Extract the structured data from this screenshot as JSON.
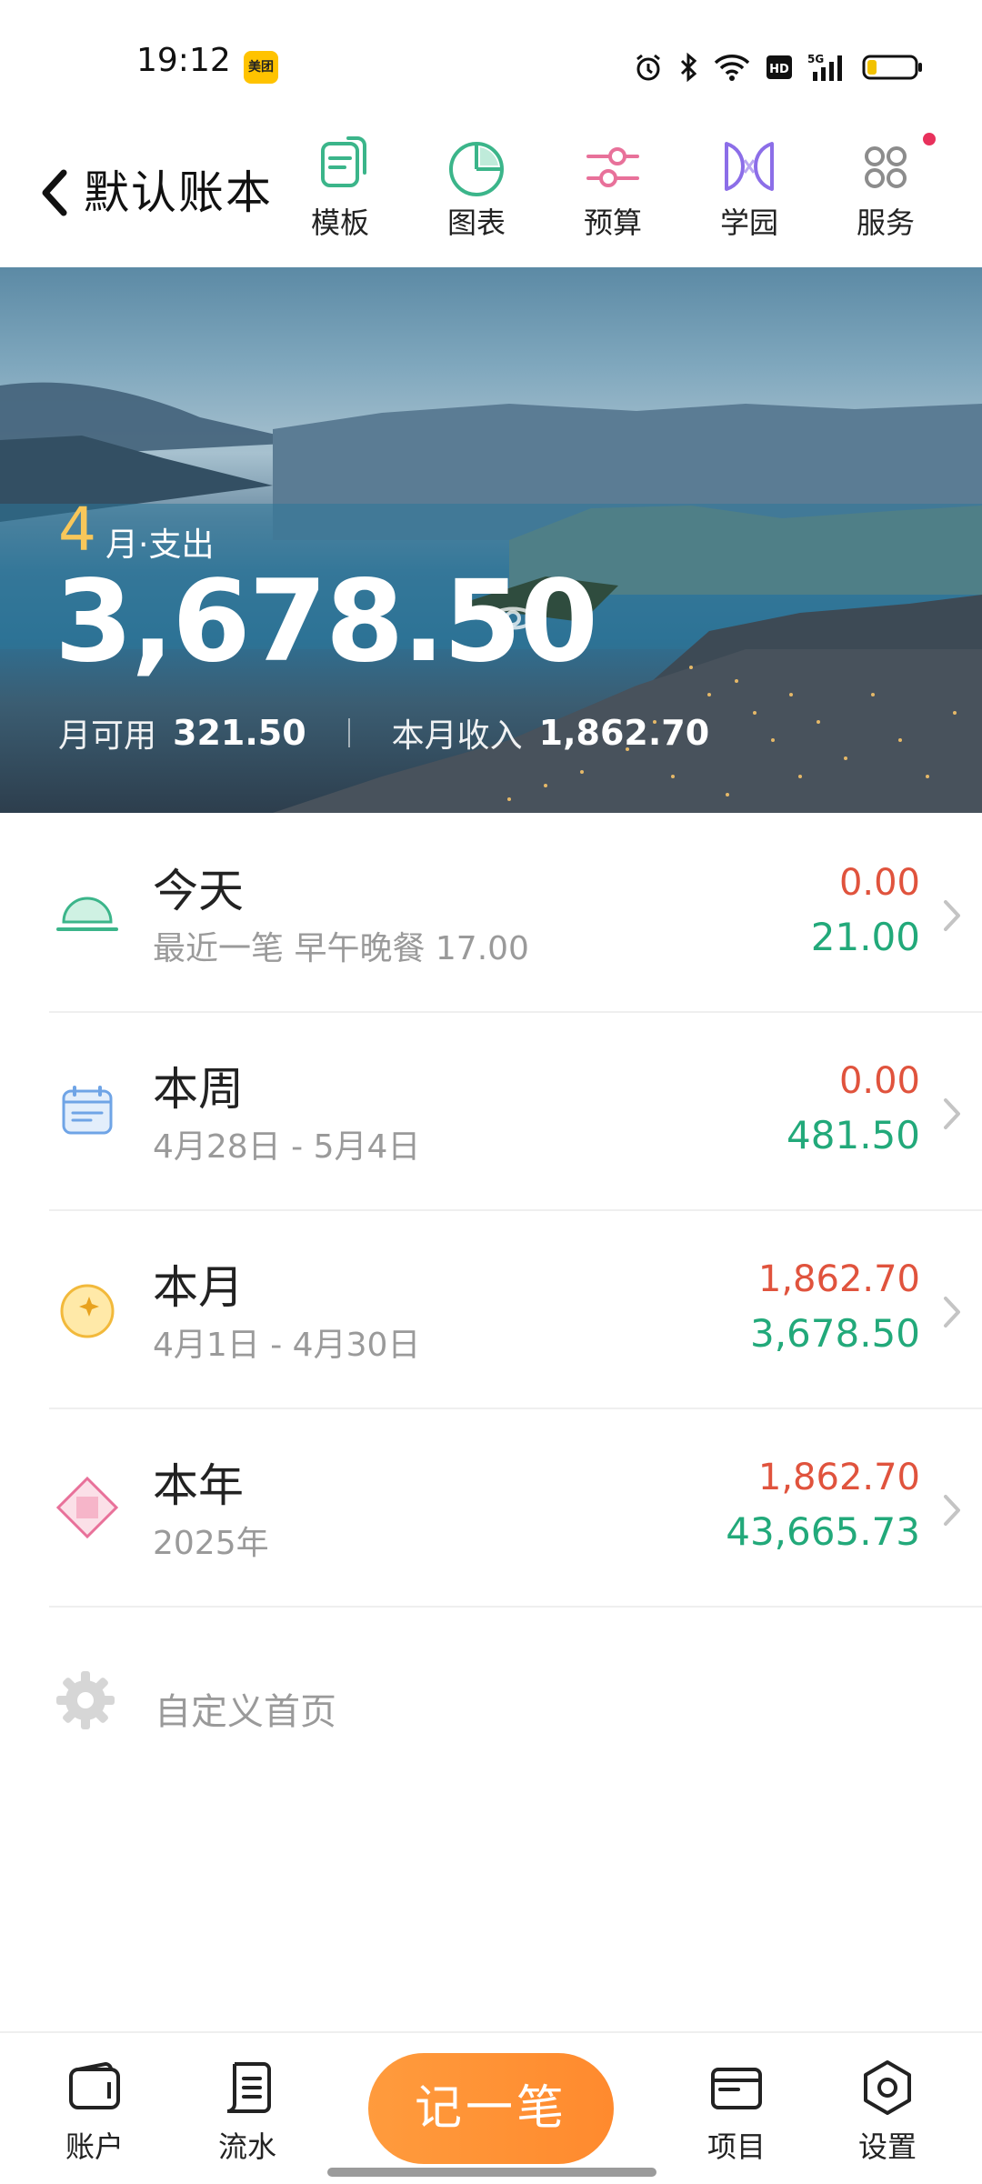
{
  "status_bar": {
    "time": "19:12",
    "app_badge": "美团",
    "icons": [
      "alarm-icon",
      "bluetooth-icon",
      "wifi-icon",
      "hd-icon",
      "5g-signal-icon",
      "battery-icon"
    ]
  },
  "header": {
    "back_icon": "chevron-left-icon",
    "title": "默认账本",
    "nav": [
      {
        "label": "模板",
        "icon": "template-icon",
        "color": "#3BB58A"
      },
      {
        "label": "图表",
        "icon": "pie-chart-icon",
        "color": "#3BB58A"
      },
      {
        "label": "预算",
        "icon": "budget-sliders-icon",
        "color": "#E8719A"
      },
      {
        "label": "学园",
        "icon": "academy-icon",
        "color": "#8C6EE8"
      },
      {
        "label": "服务",
        "icon": "service-grid-icon",
        "color": "#8C8C8C"
      }
    ]
  },
  "hero": {
    "month": "4",
    "month_suffix": "月·支出",
    "amount": "3,678.50",
    "available_label": "月可用",
    "available_value": "321.50",
    "income_label": "本月收入",
    "income_value": "1,862.70"
  },
  "summary": [
    {
      "title": "今天",
      "subtitle": "最近一笔 早午晚餐 17.00",
      "income": "0.00",
      "expense": "21.00",
      "icon": "sunrise-icon"
    },
    {
      "title": "本周",
      "subtitle": "4月28日 - 5月4日",
      "income": "0.00",
      "expense": "481.50",
      "icon": "calendar-icon"
    },
    {
      "title": "本月",
      "subtitle": "4月1日 - 4月30日",
      "income": "1,862.70",
      "expense": "3,678.50",
      "icon": "moon-icon"
    },
    {
      "title": "本年",
      "subtitle": "2025年",
      "income": "1,862.70",
      "expense": "43,665.73",
      "icon": "diamond-icon"
    }
  ],
  "customize": {
    "label": "自定义首页",
    "icon": "gear-icon"
  },
  "bottom_nav": {
    "tabs": [
      {
        "label": "账户",
        "icon": "wallet-icon"
      },
      {
        "label": "流水",
        "icon": "ledger-icon"
      },
      {
        "label": "项目",
        "icon": "folder-icon"
      },
      {
        "label": "设置",
        "icon": "settings-icon"
      }
    ],
    "record_label": "记一笔"
  },
  "colors": {
    "income": "#E0533D",
    "expense": "#22A97A",
    "accent": "#FF8A2E",
    "month_highlight": "#F8C75A"
  }
}
